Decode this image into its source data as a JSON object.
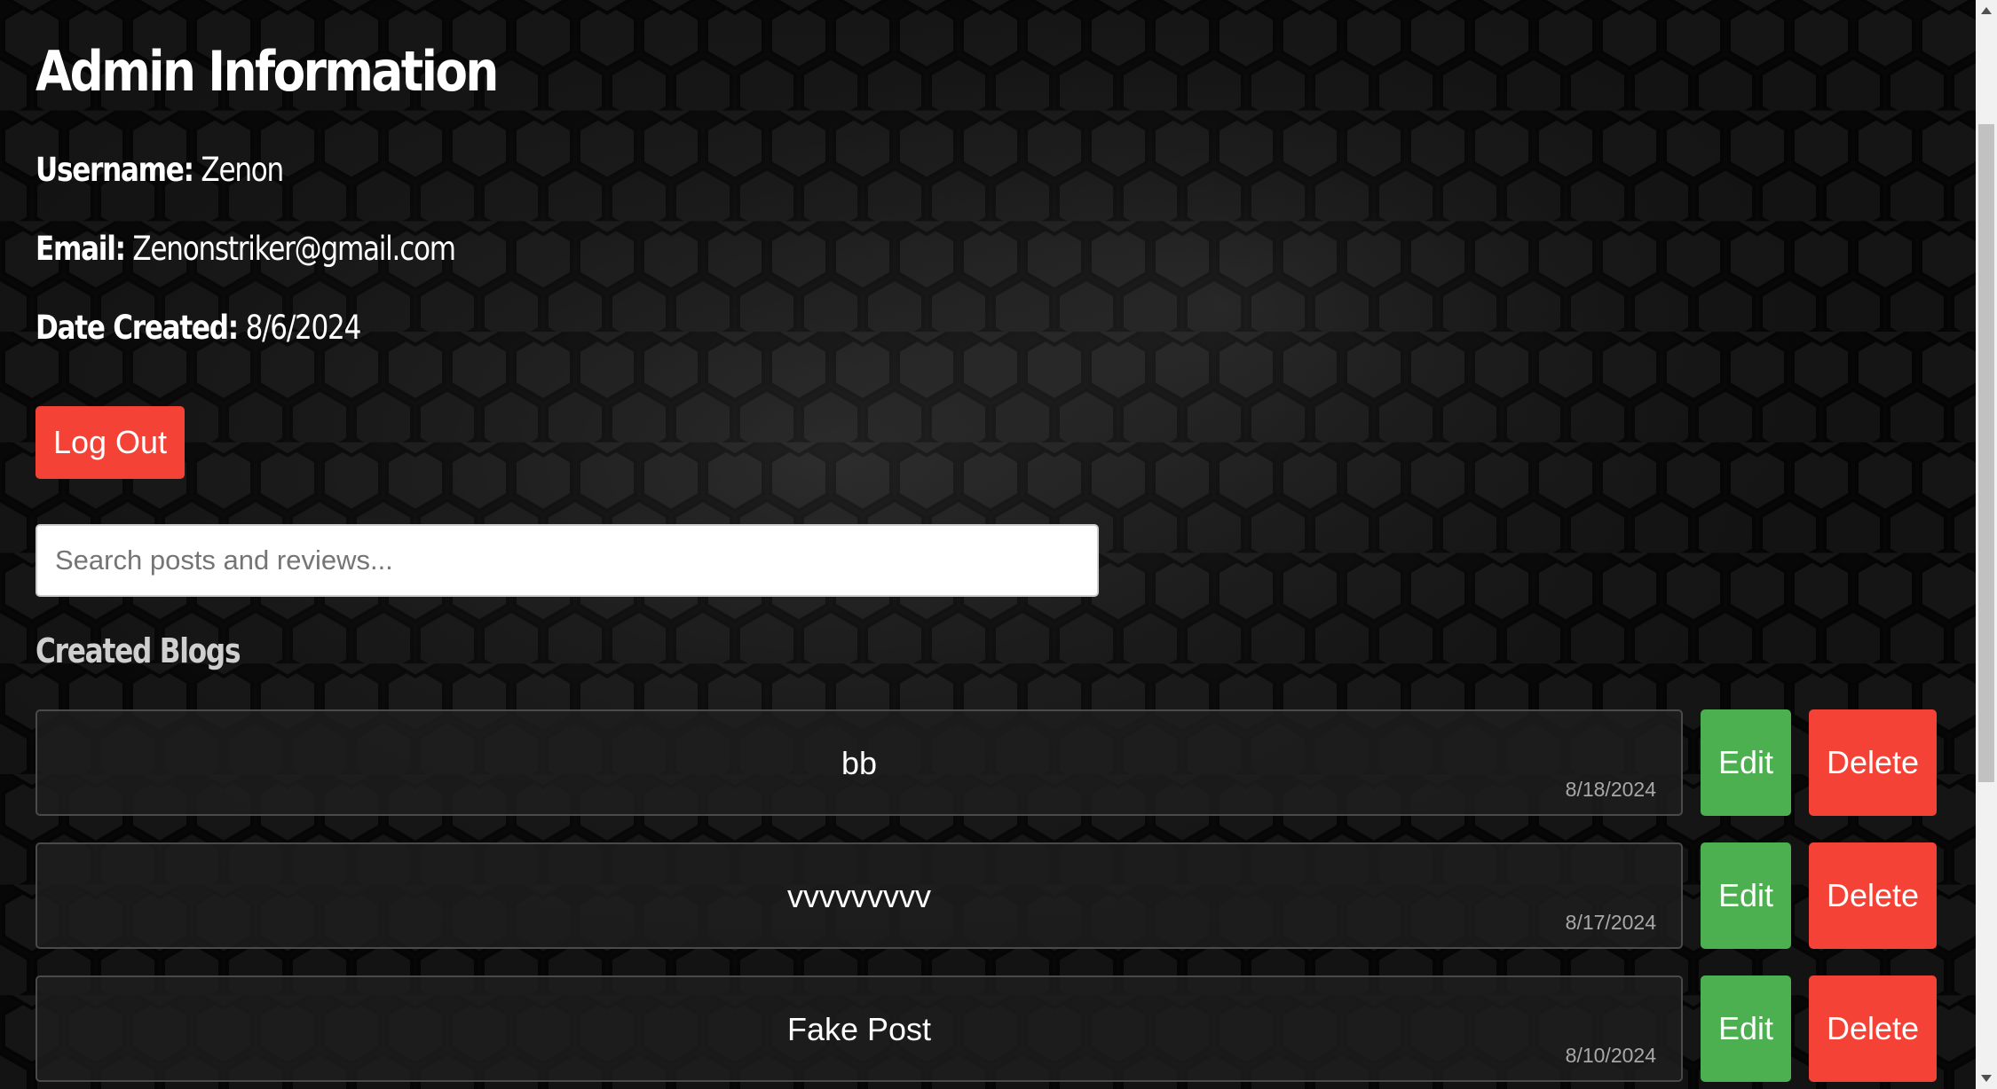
{
  "admin": {
    "heading": "Admin Information",
    "username_label": "Username:",
    "username_value": "Zenon",
    "email_label": "Email:",
    "email_value": "Zenonstriker@gmail.com",
    "date_label": "Date Created:",
    "date_value": "8/6/2024"
  },
  "logout_label": "Log Out",
  "search": {
    "placeholder": "Search posts and reviews...",
    "value": ""
  },
  "blogs": {
    "heading": "Created Blogs",
    "items": [
      {
        "title": "bb",
        "date": "8/18/2024",
        "edit_label": "Edit",
        "delete_label": "Delete"
      },
      {
        "title": "vvvvvvvvv",
        "date": "8/17/2024",
        "edit_label": "Edit",
        "delete_label": "Delete"
      },
      {
        "title": "Fake Post",
        "date": "8/10/2024",
        "edit_label": "Edit",
        "delete_label": "Delete"
      }
    ]
  },
  "colors": {
    "background": "#0a0a0a",
    "danger": "#f44336",
    "success": "#4caf50",
    "text": "#ffffff"
  }
}
